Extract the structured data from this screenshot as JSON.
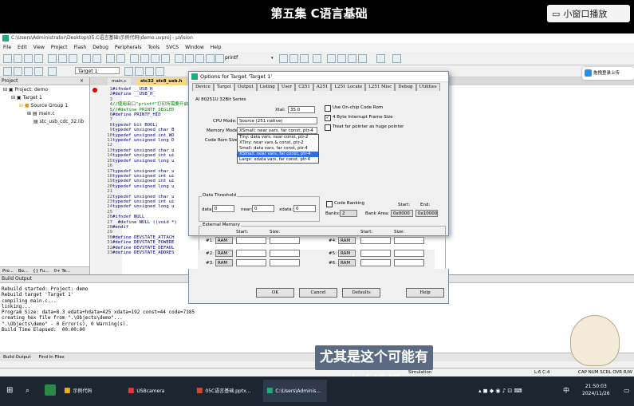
{
  "video": {
    "title": "第五集 C语言基础",
    "mini_window": "小窗口播放",
    "subtitle": "尤其是这个可能有人会选错",
    "side_button": "拖拽登录上传"
  },
  "window": {
    "title": "C:\\Users\\Administrator\\Desktop\\05.C语言基础\\示例代码\\demo.uvproj - µVision"
  },
  "menu": [
    "File",
    "Edit",
    "View",
    "Project",
    "Flash",
    "Debug",
    "Peripherals",
    "Tools",
    "SVCS",
    "Window",
    "Help"
  ],
  "toolbar": {
    "target_select": "Target 1",
    "find_text": "printf"
  },
  "project_panel": {
    "header": "Project",
    "items": [
      "Project: demo",
      "Target 1",
      "Source Group 1",
      "main.c",
      "stc_usb_cdc_32.lib"
    ],
    "bottom_tabs": [
      "Pro...",
      "Bo...",
      "{} Fu...",
      "0+ Te..."
    ]
  },
  "editor": {
    "tabs": [
      "main.c",
      "stc32_stc8_usb.h"
    ],
    "line_numbers": [
      "1",
      "2",
      "3",
      "4",
      "5",
      "6",
      "7",
      "8",
      "9",
      "10",
      "11",
      "12",
      "13",
      "14",
      "15",
      "16",
      "17",
      "18",
      "19",
      "20",
      "21",
      "22",
      "23",
      "24",
      "25",
      "26",
      "27",
      "28",
      "29",
      "30",
      "31",
      "32",
      "33"
    ],
    "lines": [
      "#ifndef __USB_H_",
      "#define __USB_H_",
      "",
      "//使用串口\"printf\"打印所需要开启以下两个定义",
      "//#define PRINTF_SEGLED",
      "#define PRINTF_HID",
      "",
      "typedef bit BOOL;",
      "typedef unsigned char B",
      "typedef unsigned int WO",
      "typedef unsigned long D",
      "",
      "typedef unsigned char u",
      "typedef unsigned int ui",
      "typedef unsigned long u",
      "",
      "typedef unsigned char u",
      "typedef unsigned int ui",
      "typedef unsigned int ui",
      "typedef unsigned long u",
      "",
      "typedef unsigned char u",
      "typedef unsigned int ui",
      "typedef unsigned long u",
      "",
      "#ifndef NULL",
      "  #define NULL ((void *)",
      "#endif",
      "",
      "#define DEVSTATE_ATTACH",
      "#define DEVSTATE_POWERE",
      "#define DEVSTATE_DEFAUL",
      "#define DEVSTATE_ADDRES"
    ]
  },
  "dialog": {
    "title": "Options for Target 'Target 1'",
    "tabs": [
      "Device",
      "Target",
      "Output",
      "Listing",
      "User",
      "C251",
      "A251",
      "L251 Locate",
      "L251 Misc",
      "Debug",
      "Utilities"
    ],
    "chip": "AI 80251U 32Bit Series",
    "xtal_label": "Xtal:",
    "xtal_value": "35.0",
    "cpu_mode_label": "CPU Mode:",
    "cpu_mode_value": "Source (251 native)",
    "memory_model_label": "Memory Model:",
    "memory_model_value": "XSmall: near vars, far const, ptr-4",
    "code_rom_label": "Code Rom Size:",
    "memory_options": [
      "Tiny: data vars, near const, ptr-2",
      "XTiny: near vars & const, ptr-2",
      "Small: data vars, far const, ptr-4",
      "XSmall: near vars, far const, ptr-4",
      "Large: xdata vars, far const, ptr-4"
    ],
    "selected_memory_index": 3,
    "use_onchip": "Use On-chip Code Rom",
    "byte4_interrupt": "4 Byte Interrupt Frame Size",
    "far_pointer": "Treat far pointer as huge pointer",
    "data_threshold": "Data Threshold",
    "data_label": "data:",
    "data_value": "0",
    "near_label": "near:",
    "near_value": "0",
    "xdata_label": "xdata:",
    "xdata_value": "0",
    "code_banking": "Code Banking",
    "start_label": "Start:",
    "end_label": "End:",
    "banks_label": "Banks:",
    "banks_value": "2",
    "bank_area_label": "Bank Area:",
    "bank_start": "0x0000",
    "bank_end": "0x10000",
    "external_memory": "External Memory",
    "size_label": "Size:",
    "ram_rows_left": [
      "#1:",
      "#2:",
      "#3:"
    ],
    "ram_rows_right": [
      "#4:",
      "#5:",
      "#6:"
    ],
    "ram_value": "RAM",
    "buttons": [
      "OK",
      "Cancel",
      "Defaults",
      "Help"
    ]
  },
  "build_output": {
    "header": "Build Output",
    "lines": [
      "Rebuild started: Project: demo",
      "Rebuild target 'Target 1'",
      "compiling main.c...",
      "linking...",
      "Program Size: data=8.3 edata+hdata=425 xdata=192 const=44 code=7185",
      "creating hex file from \".\\Objects\\demo\"...",
      "\".\\Objects\\demo\" - 0 Error(s), 0 Warning(s).",
      "Build Time Elapsed:  00:00:00"
    ],
    "tabs": [
      "Build Output",
      "Find In Files"
    ]
  },
  "status": {
    "sim": "Simulation",
    "pos": "L:6 C:4",
    "flags": "CAP NUM SCRL OVR R/W"
  },
  "taskbar": {
    "apps": [
      "示例代码",
      "USBcamera",
      "05C语言基础.pptx...",
      "C:\\Users\\Adminis..."
    ],
    "time": "21:50:03",
    "date": "2024/11/26",
    "ime": "中"
  }
}
